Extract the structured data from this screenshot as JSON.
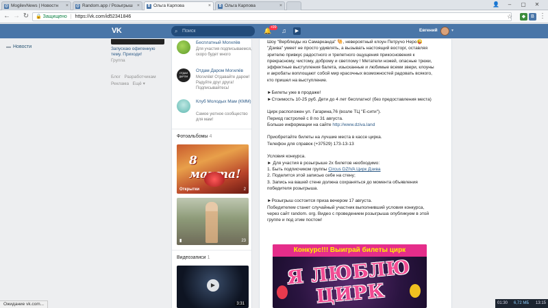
{
  "browser": {
    "tabs": [
      {
        "label": "MogilevNews | Новостн",
        "icon": "mail-tab-icon",
        "active": false
      },
      {
        "label": "Random.app / Розыгрыш",
        "icon": "mail-tab-icon",
        "active": false
      },
      {
        "label": "Ольга Карпова",
        "icon": "vk-tab-icon",
        "active": true
      },
      {
        "label": "Ольга Карпова",
        "icon": "vk-tab-icon",
        "active": false
      }
    ],
    "secure_label": "Защищено",
    "url": "https://vk.com/id52341846",
    "status_text": "Ожидание vk.com..."
  },
  "header": {
    "logo": "VK",
    "search_placeholder": "Поиск",
    "notifications_count": "+99",
    "user_name": "Евгений"
  },
  "left_nav": {
    "news_label": "Новости"
  },
  "profile_column": {
    "link_lines": [
      "Запускаю офигенную",
      "тему. Приходи!"
    ],
    "group_label": "Группа",
    "footer_row1": [
      "Блог",
      "Разработчикам"
    ],
    "footer_row2": [
      "Реклама",
      "Ещё"
    ]
  },
  "groups": [
    {
      "name": "Бесплатный Могилёв",
      "desc": "Для участия подписываемся, скоро будет много",
      "color": "#7fbf3f"
    },
    {
      "name": "Отдам Даром Могилёв",
      "desc": "Могилёв! Отдавайте даром! Радуйте друг друга! Подписывайтесь!",
      "color": "#222222",
      "logo_text": "ОТДАМ ДАРОМ"
    },
    {
      "name": "Клуб Молодых Мам (КММ)",
      "desc": "Самое уютное сообщество для мам!",
      "color": "#6fc4c0"
    }
  ],
  "photos": {
    "title": "Фотоальбомы",
    "count": "4",
    "albums": [
      {
        "caption": "Открытки",
        "count": "2",
        "art_text": "8 марта!"
      },
      {
        "caption": "",
        "count": "23"
      }
    ]
  },
  "videos": {
    "title": "Видеозаписи",
    "count": "1",
    "duration": "3:31"
  },
  "post": {
    "lines": [
      {
        "t": "Шоу \"Верблюды из Самарканда\" 🐫, невероятный клоун Петручо Неро😜"
      },
      {
        "t": "\"Дзива\" умеет не просто удивлять, а вызывать настоящий восторг, оставляя"
      },
      {
        "t": "зрителю привкус радостного и трепетного ощущения прикосновения к"
      },
      {
        "t": "прекрасному, чистому, доброму и светлому ! Метатели ножей, опасные трюки,"
      },
      {
        "t": "эффектные выступления балета, изысканные и любимые всеми звери, клоуны"
      },
      {
        "t": "и акробаты воплощают собой мир красочных возможностей радовать всякого,"
      },
      {
        "t": "кто пришел на выступление."
      },
      {
        "t": ""
      },
      {
        "t": "►Билеты уже в продаже!"
      },
      {
        "t": "►Стоимость 10-25 руб. Дети до 4 лет бесплатно! (без предоставления места)"
      },
      {
        "t": ""
      },
      {
        "t": "Цирк расположен ул. Гагарина,76 (возле ТЦ \"Е-сити\")."
      },
      {
        "t": "Период гастролей с 8 по 31 августа."
      },
      {
        "t": "Больше информации на сайте ",
        "link": "http://www.dziva.land"
      },
      {
        "t": ""
      },
      {
        "t": "Приобретайте билеты на лучшие места в кассе цирка."
      },
      {
        "t": "Телефон для справок (+37529) 173-13-13"
      },
      {
        "t": ""
      },
      {
        "t": "Условия конкурса."
      },
      {
        "t": "► Для участия в розыгрыше 2х билетов необходимо:"
      },
      {
        "t": "1. Быть подписчиком группы ",
        "link": "Circus DZIVA Цирк Дзива",
        "underline": true
      },
      {
        "t": "2. Поделится этой записью себе на стену;"
      },
      {
        "t": "3. Запись на вашей стене должна сохраняться до момента объявления"
      },
      {
        "t": "победителя розыгрыша."
      },
      {
        "t": ""
      },
      {
        "t": "►Розыгрыш состоится приза вечером 17 августа."
      },
      {
        "t": "Победителем станет случайный участник выполнивший условия конкурса,"
      },
      {
        "t": "через сайт random. org. Видео с проведением розыгрыша опубликуем в этой"
      },
      {
        "t": "группе и под этим постом!"
      }
    ],
    "banner_title": "Конкурс!!! Выиграй билеты цирк",
    "banner_art": "Я ЛЮБЛЮ ЦИРК"
  },
  "tray": {
    "time1": "01:30",
    "size": "6,72 МБ",
    "time2": "13:15"
  }
}
